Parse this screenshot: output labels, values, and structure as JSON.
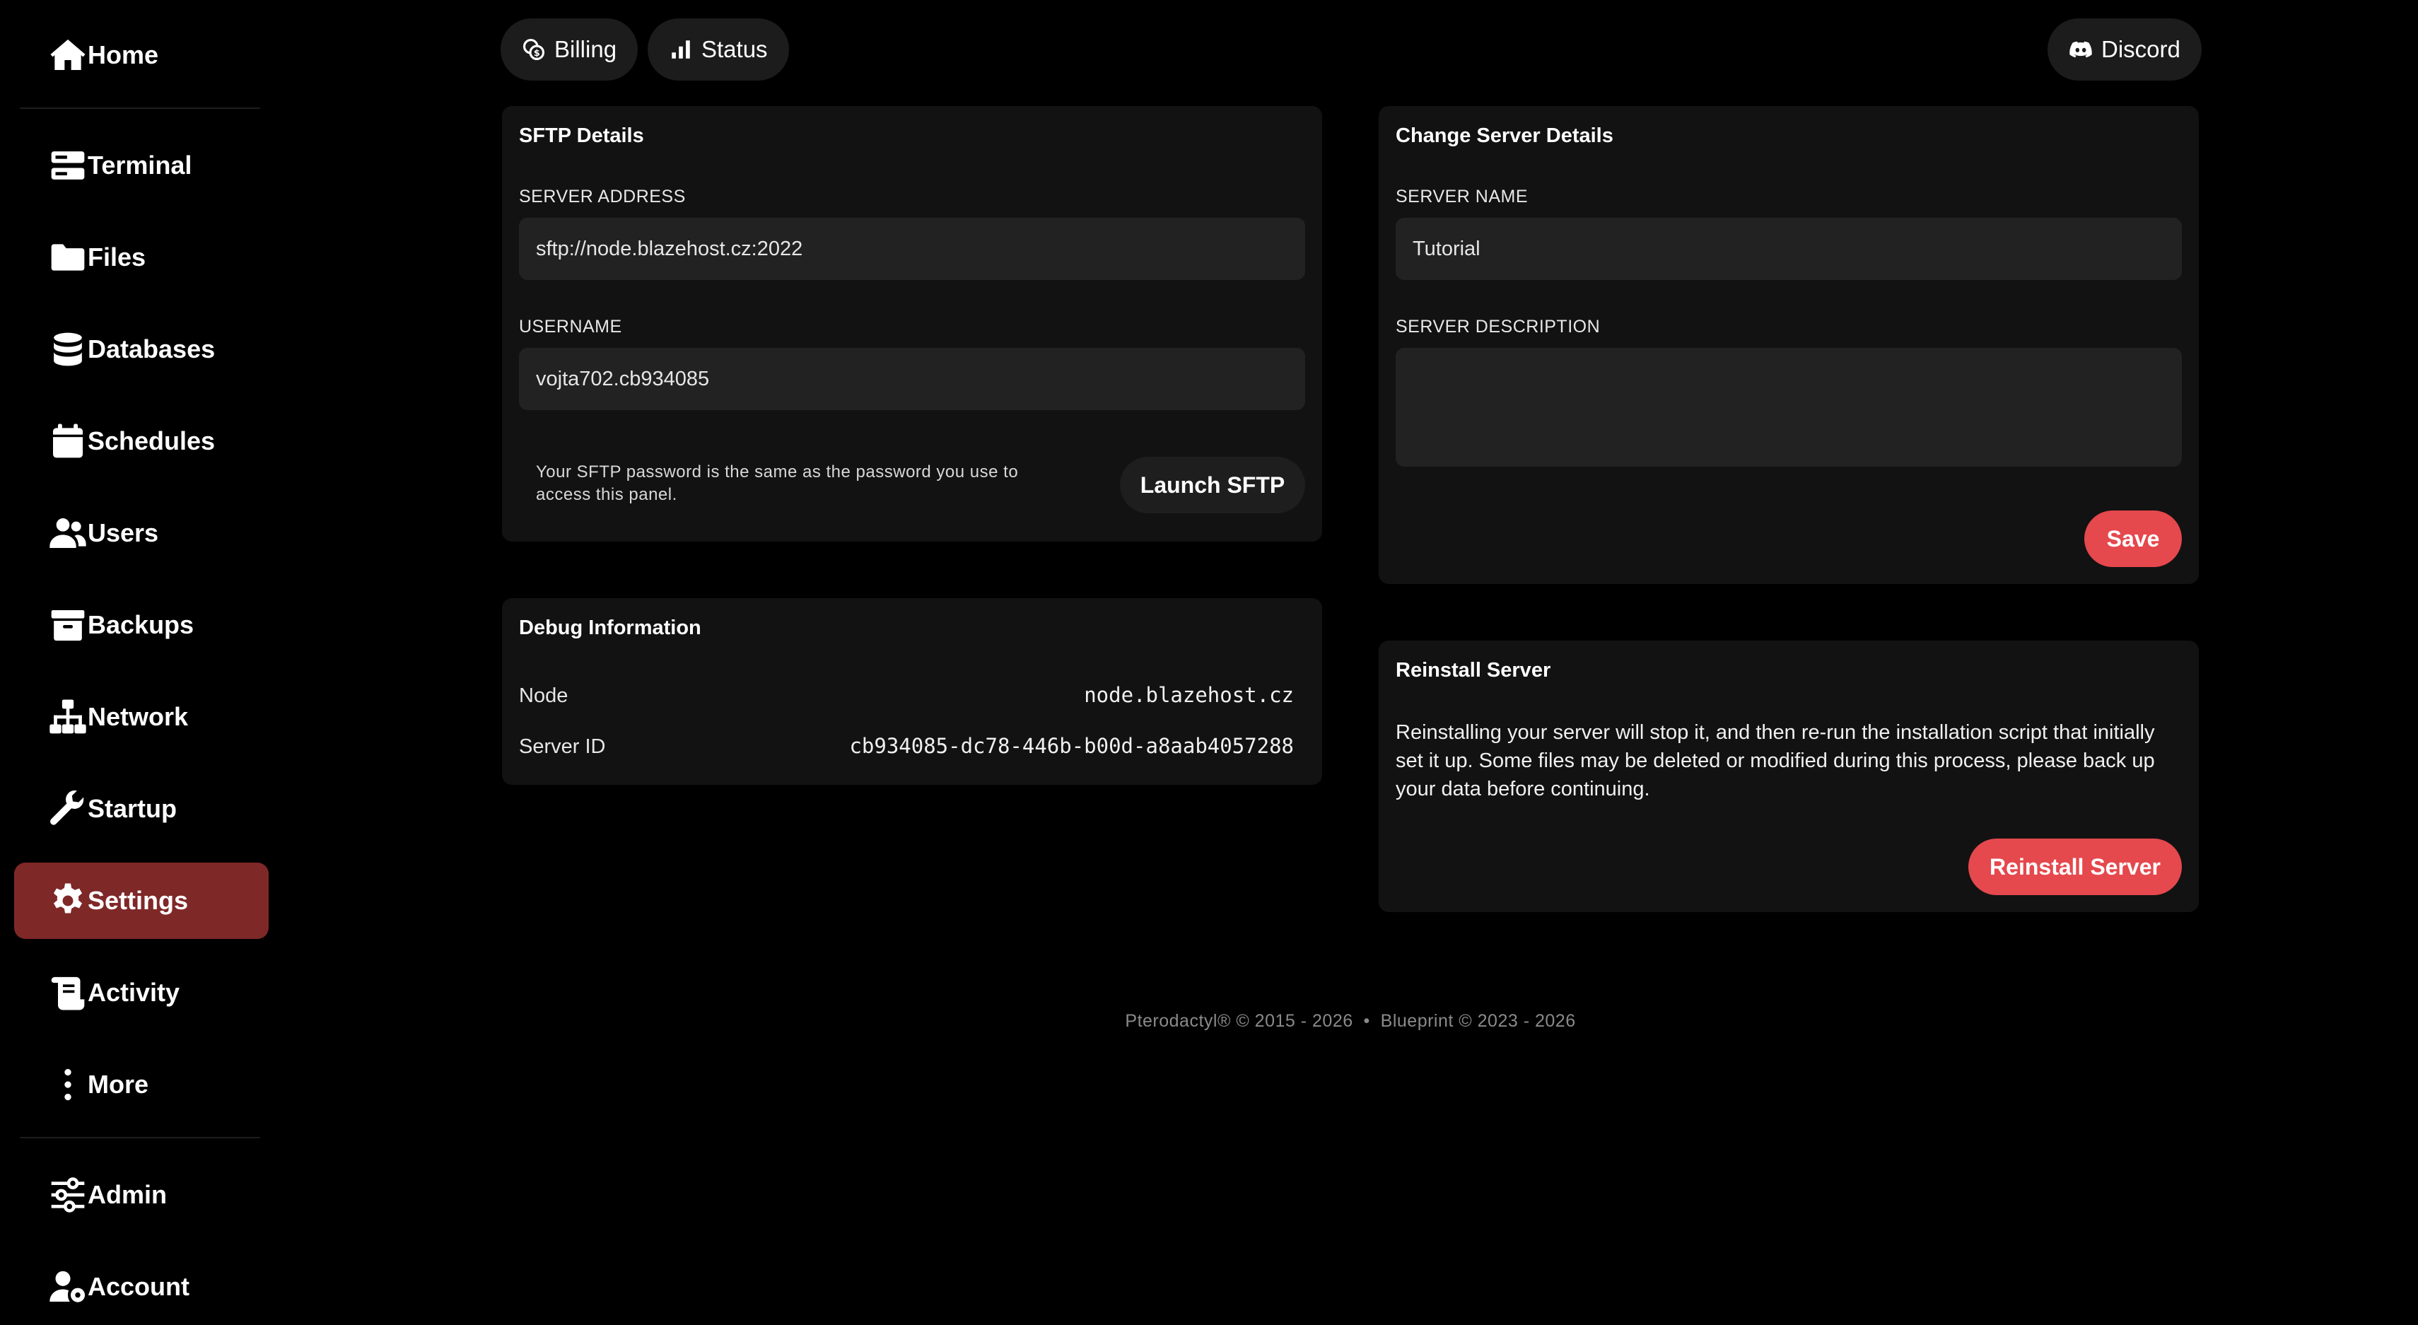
{
  "sidebar": {
    "items": [
      {
        "label": "Home",
        "icon": "home-icon"
      },
      {
        "label": "Terminal",
        "icon": "terminal-icon"
      },
      {
        "label": "Files",
        "icon": "folder-icon"
      },
      {
        "label": "Databases",
        "icon": "database-icon"
      },
      {
        "label": "Schedules",
        "icon": "calendar-icon"
      },
      {
        "label": "Users",
        "icon": "users-icon"
      },
      {
        "label": "Backups",
        "icon": "archive-icon"
      },
      {
        "label": "Network",
        "icon": "network-icon"
      },
      {
        "label": "Startup",
        "icon": "wrench-icon"
      },
      {
        "label": "Settings",
        "icon": "gear-icon"
      },
      {
        "label": "Activity",
        "icon": "scroll-icon"
      },
      {
        "label": "More",
        "icon": "more-vertical-icon"
      },
      {
        "label": "Admin",
        "icon": "sliders-icon"
      },
      {
        "label": "Account",
        "icon": "user-gear-icon"
      }
    ],
    "active": "Settings",
    "active_color": "#7f2828"
  },
  "header": {
    "billing_label": "Billing",
    "status_label": "Status",
    "discord_label": "Discord"
  },
  "sftp": {
    "title": "SFTP Details",
    "address_label": "SERVER ADDRESS",
    "address_value": "sftp://node.blazehost.cz:2022",
    "username_label": "USERNAME",
    "username_value": "vojta702.cb934085",
    "note": "Your SFTP password is the same as the password you use to access this panel.",
    "launch_label": "Launch SFTP"
  },
  "debug": {
    "title": "Debug Information",
    "node_label": "Node",
    "node_value": "node.blazehost.cz",
    "server_id_label": "Server ID",
    "server_id_value": "cb934085-dc78-446b-b00d-a8aab4057288"
  },
  "change": {
    "title": "Change Server Details",
    "name_label": "SERVER NAME",
    "name_value": "Tutorial",
    "description_label": "SERVER DESCRIPTION",
    "description_value": "",
    "save_label": "Save"
  },
  "reinstall": {
    "title": "Reinstall Server",
    "text": "Reinstalling your server will stop it, and then re-run the installation script that initially set it up. Some files may be deleted or modified during this process, please back up your data before continuing.",
    "button_label": "Reinstall Server"
  },
  "footer": {
    "text": "Pterodactyl® © 2015 - 2026  •  Blueprint © 2023 - 2026"
  },
  "colors": {
    "accent_red": "#e5484d",
    "background": "#000000",
    "panel": "#121212"
  }
}
